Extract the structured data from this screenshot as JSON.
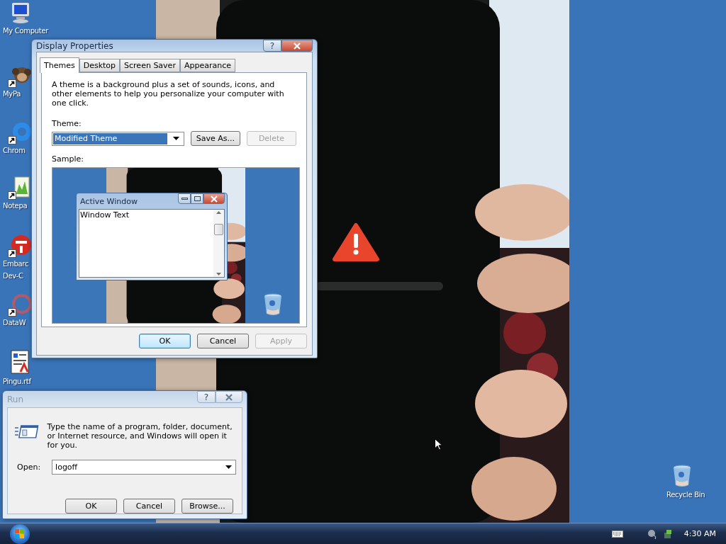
{
  "desktop_icons": [
    {
      "kind": "computer",
      "shortcut": false,
      "lines": [
        "My Computer"
      ]
    },
    {
      "kind": "app",
      "shortcut": true,
      "lines": [
        "MyPa"
      ]
    },
    {
      "kind": "browser",
      "shortcut": true,
      "lines": [
        "Chrom"
      ]
    },
    {
      "kind": "notepad",
      "shortcut": true,
      "lines": [
        "Notepa"
      ]
    },
    {
      "kind": "dev",
      "shortcut": true,
      "lines": [
        "Embarc",
        "Dev-C"
      ]
    },
    {
      "kind": "data",
      "shortcut": true,
      "lines": [
        "DataW"
      ]
    },
    {
      "kind": "document",
      "shortcut": false,
      "lines": [
        "Pingu.rtf"
      ]
    },
    {
      "kind": "recycle",
      "shortcut": false,
      "lines": [
        "Recycle Bin"
      ]
    }
  ],
  "display_properties": {
    "title": "Display Properties",
    "active": true,
    "help": "?",
    "tabs": [
      {
        "label": "Themes",
        "selected": true
      },
      {
        "label": "Desktop",
        "selected": false
      },
      {
        "label": "Screen Saver",
        "selected": false
      },
      {
        "label": "Appearance",
        "selected": false
      }
    ],
    "description": "A theme is a background plus a set of sounds, icons, and other elements to help you personalize your computer with one click.",
    "theme_label": "Theme:",
    "theme_value": "Modified Theme",
    "theme_buttons": [
      {
        "label": "Save As...",
        "disabled": false
      },
      {
        "label": "Delete",
        "disabled": true
      }
    ],
    "sample_label": "Sample:",
    "sample": {
      "window_title": "Active Window",
      "window_text": "Window Text"
    },
    "buttons": [
      {
        "label": "OK",
        "default": true,
        "disabled": false
      },
      {
        "label": "Cancel",
        "default": false,
        "disabled": false
      },
      {
        "label": "Apply",
        "default": false,
        "disabled": true
      }
    ]
  },
  "run": {
    "title": "Run",
    "active": false,
    "help": "?",
    "description": "Type the name of a program, folder, document, or Internet resource, and Windows will open it for you.",
    "open_label": "Open:",
    "open_value": "logoff",
    "buttons": [
      {
        "label": "OK",
        "default": false,
        "disabled": false
      },
      {
        "label": "Cancel",
        "default": false,
        "disabled": false
      },
      {
        "label": "Browse...",
        "default": false,
        "disabled": false
      }
    ]
  },
  "taskbar": {
    "clock": "4:30 AM"
  }
}
